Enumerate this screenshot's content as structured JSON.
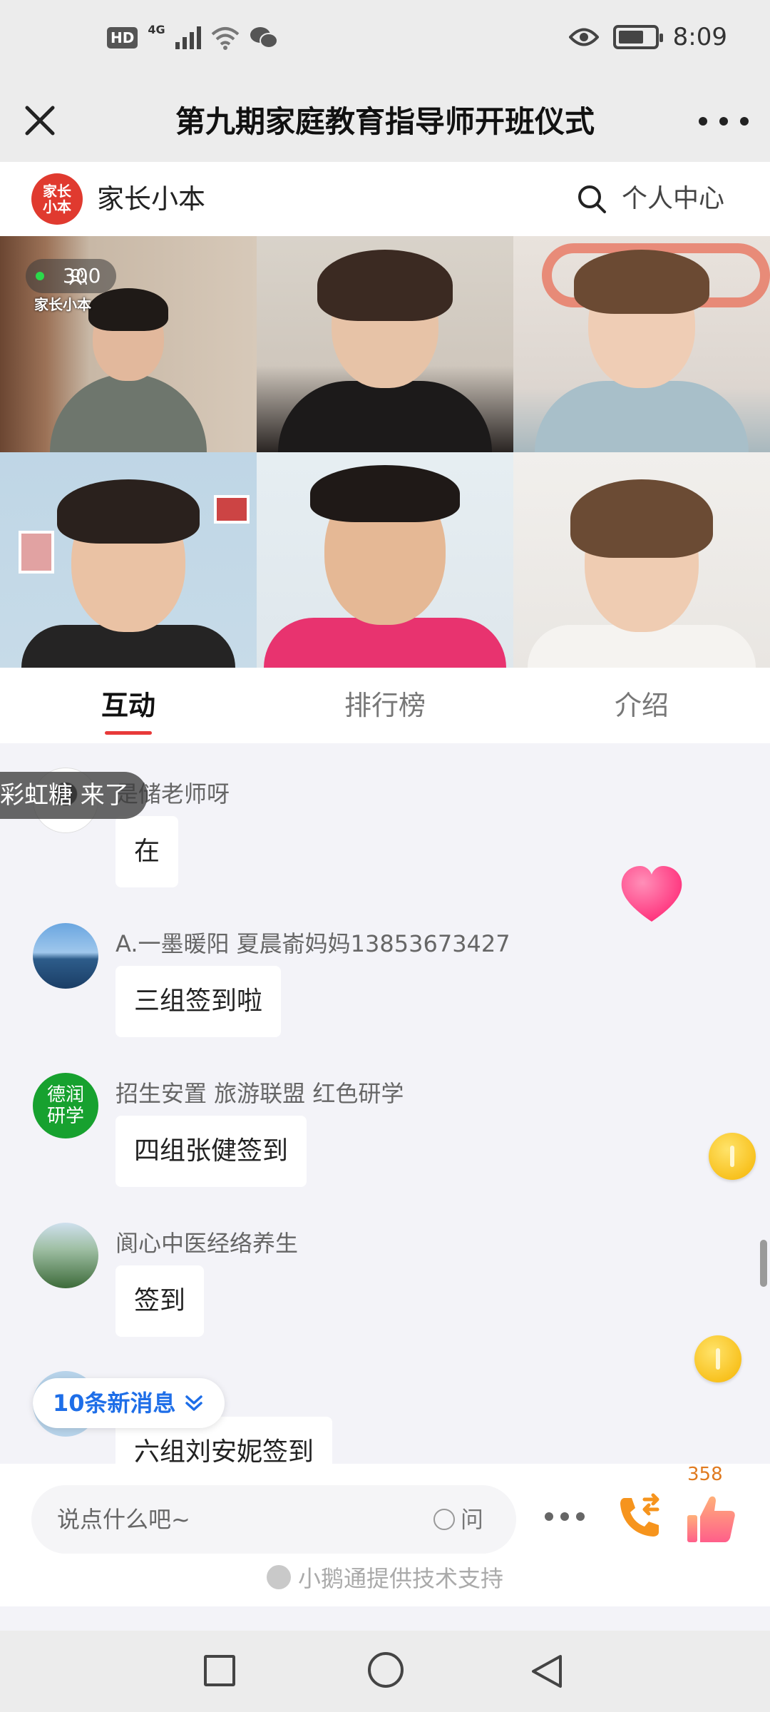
{
  "status_bar": {
    "hd": "HD",
    "network": "4G",
    "time": "8:09",
    "battery_level": 0.7
  },
  "header": {
    "title": "第九期家庭教育指导师开班仪式"
  },
  "brand_bar": {
    "logo_text": "家长小本",
    "name": "家长小本",
    "personal_center": "个人中心"
  },
  "live": {
    "viewer_count": "300",
    "brand_watermark": "家长小本"
  },
  "tabs": [
    {
      "label": "互动",
      "active": true
    },
    {
      "label": "排行榜",
      "active": false
    },
    {
      "label": "介绍",
      "active": false
    }
  ],
  "chat": {
    "arrival_toast": "彩虹糖 来了",
    "messages": [
      {
        "sender": "是储老师呀",
        "text": "在"
      },
      {
        "sender": "A.一墨暖阳 夏晨嵛妈妈13853673427",
        "text": "三组签到啦"
      },
      {
        "sender": "招生安置 旅游联盟 红色研学",
        "text": "四组张健签到",
        "avatar_text": "德润研学"
      },
      {
        "sender": "阆心中医经络养生",
        "text": "签到"
      },
      {
        "sender": "",
        "text": "六组刘安妮签到"
      }
    ],
    "new_messages": "10条新消息"
  },
  "input_bar": {
    "placeholder": "说点什么吧~",
    "ask_label": "问",
    "like_count": "358",
    "tech_support": "小鹅通提供技术支持"
  },
  "colors": {
    "accent_red": "#e83a3a",
    "link_blue": "#1e6ee8",
    "like_orange": "#e07a1f"
  }
}
